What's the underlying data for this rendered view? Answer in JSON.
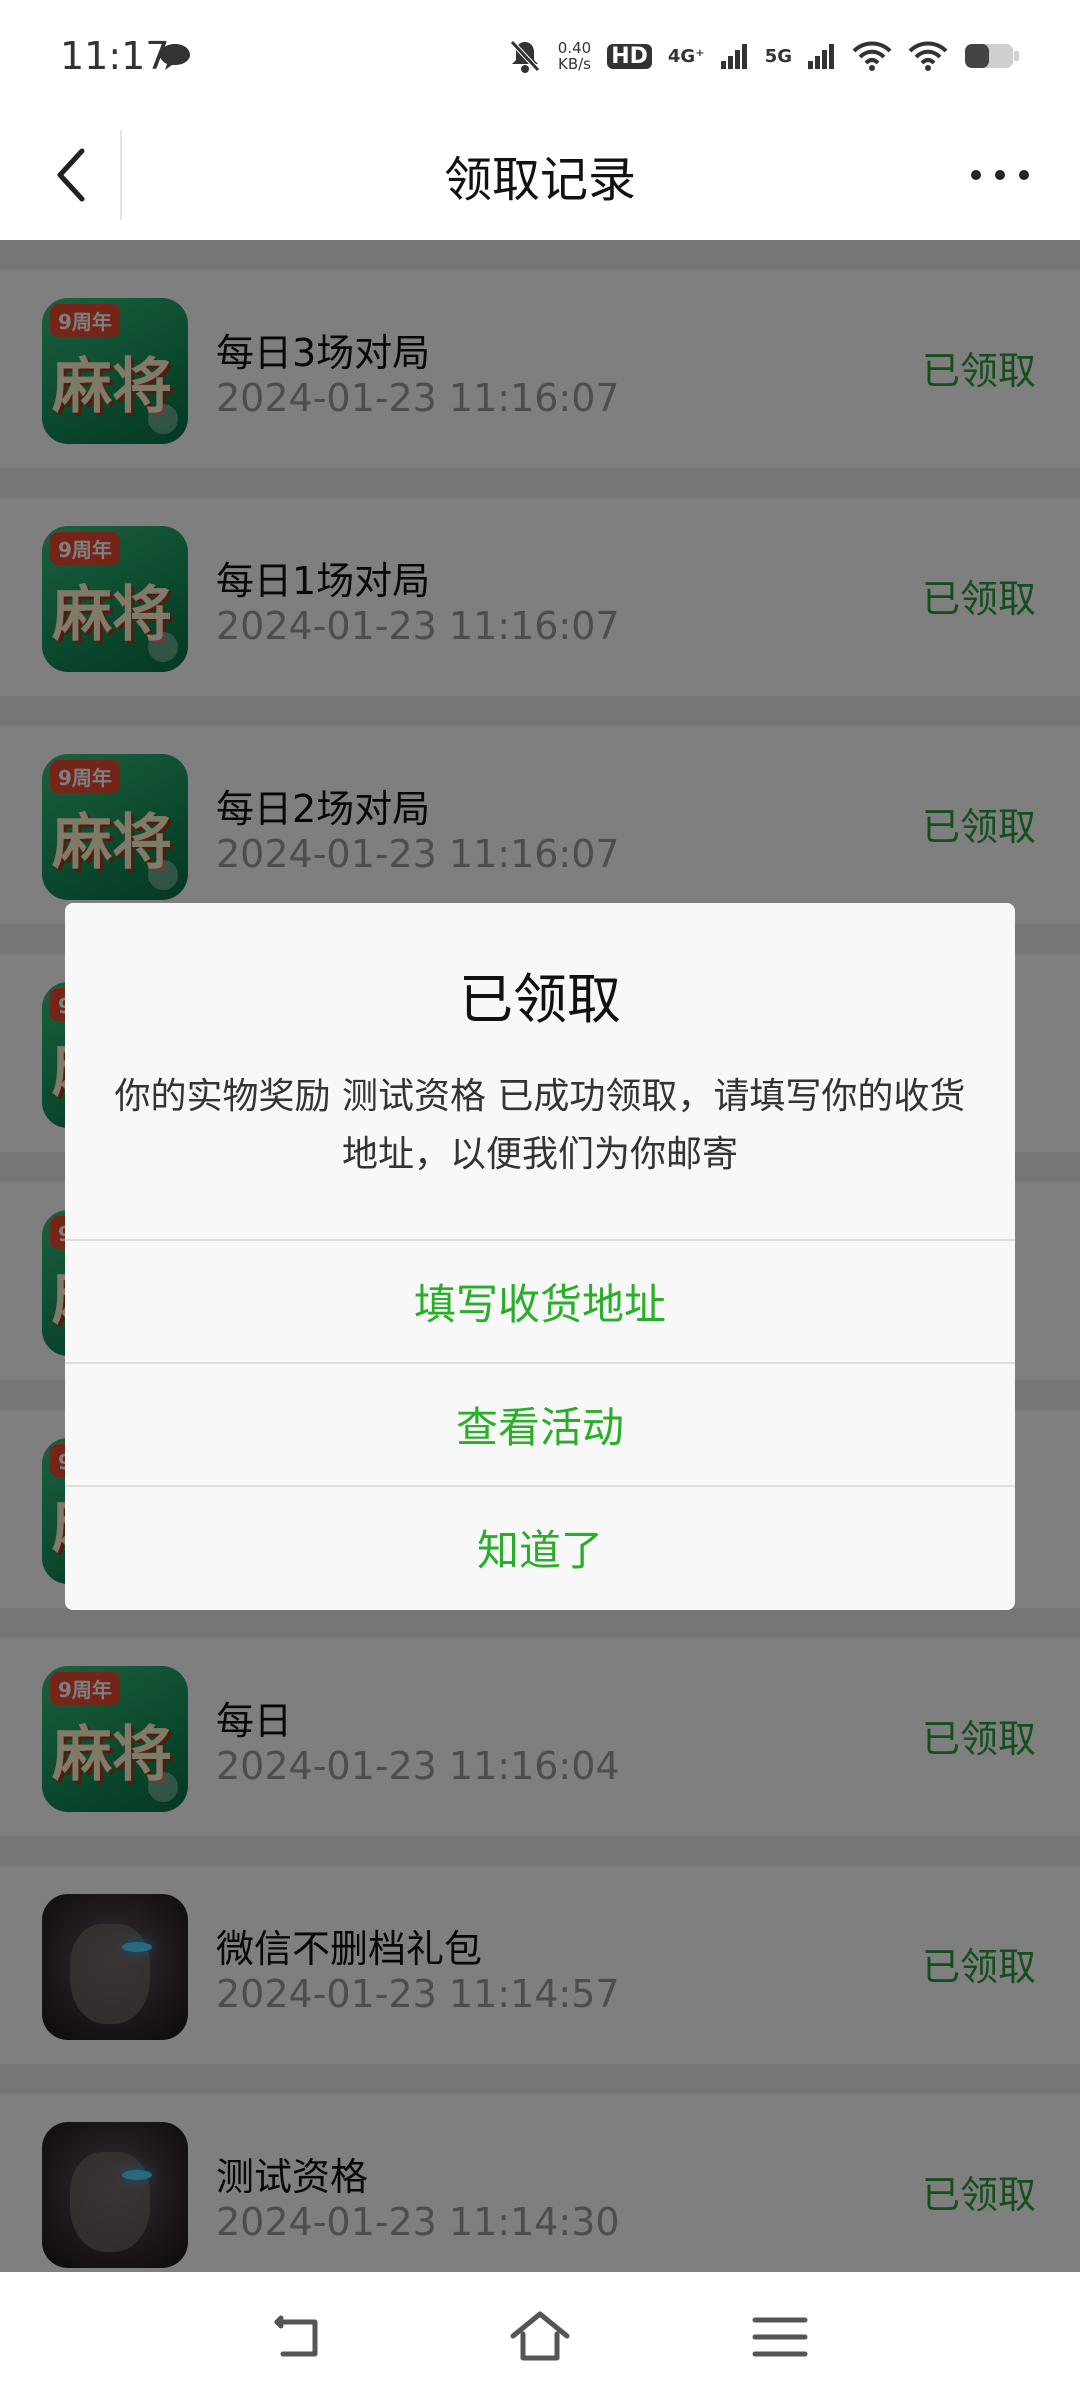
{
  "status_bar": {
    "time": "11:17",
    "net_speed": "0.40",
    "net_speed_unit": "KB/s",
    "hd_label": "HD",
    "sim1_label": "4G⁺",
    "sim2_label": "5G",
    "icons": [
      "message-icon",
      "mute-icon",
      "signal-icon",
      "wifi-icon",
      "battery-icon"
    ]
  },
  "header": {
    "title": "领取记录"
  },
  "items": [
    {
      "title": "每日3场对局",
      "time": "2024-01-23 11:16:07",
      "status": "已领取",
      "icon": "mahjong"
    },
    {
      "title": "每日1场对局",
      "time": "2024-01-23 11:16:07",
      "status": "已领取",
      "icon": "mahjong"
    },
    {
      "title": "每日2场对局",
      "time": "2024-01-23 11:16:07",
      "status": "已领取",
      "icon": "mahjong"
    },
    {
      "title": "",
      "time": "",
      "status": "",
      "icon": "mahjong"
    },
    {
      "title": "",
      "time": "",
      "status": "",
      "icon": "mahjong"
    },
    {
      "title": "",
      "time": "",
      "status": "",
      "icon": "mahjong"
    },
    {
      "title": "每日",
      "time": "2024-01-23 11:16:04",
      "status": "已领取",
      "icon": "mahjong"
    },
    {
      "title": "微信不删档礼包",
      "time": "2024-01-23 11:14:57",
      "status": "已领取",
      "icon": "hero"
    },
    {
      "title": "测试资格",
      "time": "2024-01-23 11:14:30",
      "status": "已领取",
      "icon": "hero"
    }
  ],
  "icon_badge": "9周年",
  "icon_glyph": "麻将",
  "dialog": {
    "title": "已领取",
    "message": "你的实物奖励 测试资格 已成功领取，请填写你的收货地址，以便我们为你邮寄",
    "buttons": [
      "填写收货地址",
      "查看活动",
      "知道了"
    ]
  },
  "colors": {
    "accent_green": "#2aae2a",
    "status_green": "#2a9d3a",
    "overlay": "rgba(0,0,0,0.5)"
  }
}
